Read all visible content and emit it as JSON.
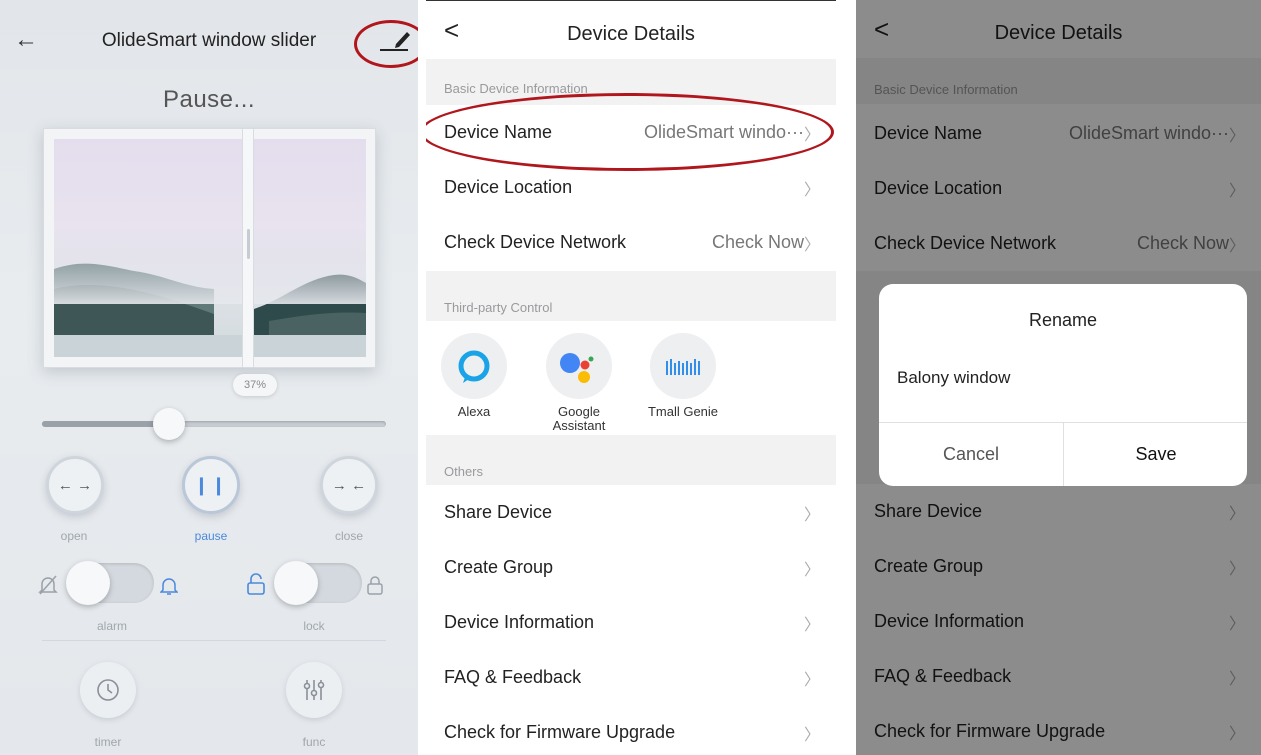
{
  "panel1": {
    "title": "OlideSmart window slider",
    "status": "Pause...",
    "percent_label": "37%",
    "percent_value": 37,
    "controls": {
      "open": "open",
      "pause": "pause",
      "close": "close"
    },
    "toggles": {
      "alarm": "alarm",
      "lock": "lock"
    },
    "bottom": {
      "timer": "timer",
      "func": "func"
    }
  },
  "details": {
    "title": "Device Details",
    "sections": {
      "basic": "Basic Device Information",
      "third_party": "Third-party Control",
      "others": "Others"
    },
    "rows": {
      "device_name": {
        "label": "Device Name",
        "value": "OlideSmart windo···"
      },
      "device_location": {
        "label": "Device Location"
      },
      "check_network": {
        "label": "Check Device Network",
        "value": "Check Now"
      },
      "share_device": {
        "label": "Share Device"
      },
      "create_group": {
        "label": "Create Group"
      },
      "device_information": {
        "label": "Device Information"
      },
      "faq": {
        "label": "FAQ & Feedback"
      },
      "firmware": {
        "label": "Check for Firmware Upgrade"
      }
    },
    "third_party": {
      "alexa": "Alexa",
      "google_line1": "Google",
      "google_line2": "Assistant",
      "tmall": "Tmall Genie"
    }
  },
  "rename_dialog": {
    "title": "Rename",
    "input_value": "Balony window",
    "cancel": "Cancel",
    "save": "Save"
  },
  "colors": {
    "accent_blue": "#4a89dc",
    "annotation_red": "#b0161b",
    "google_blue": "#4285f4",
    "google_red": "#ea4335",
    "google_yellow": "#fbbc04",
    "google_green": "#34a853"
  },
  "icons": [
    "back-arrow-icon",
    "edit-pencil-icon",
    "expand-arrows-icon",
    "pause-icon",
    "collapse-arrows-icon",
    "bell-off-icon",
    "bell-icon",
    "lock-icon",
    "unlock-icon",
    "clock-icon",
    "sliders-icon",
    "chevron-left-icon",
    "chevron-right-icon",
    "alexa-icon",
    "google-assistant-icon",
    "tmall-genie-icon"
  ]
}
